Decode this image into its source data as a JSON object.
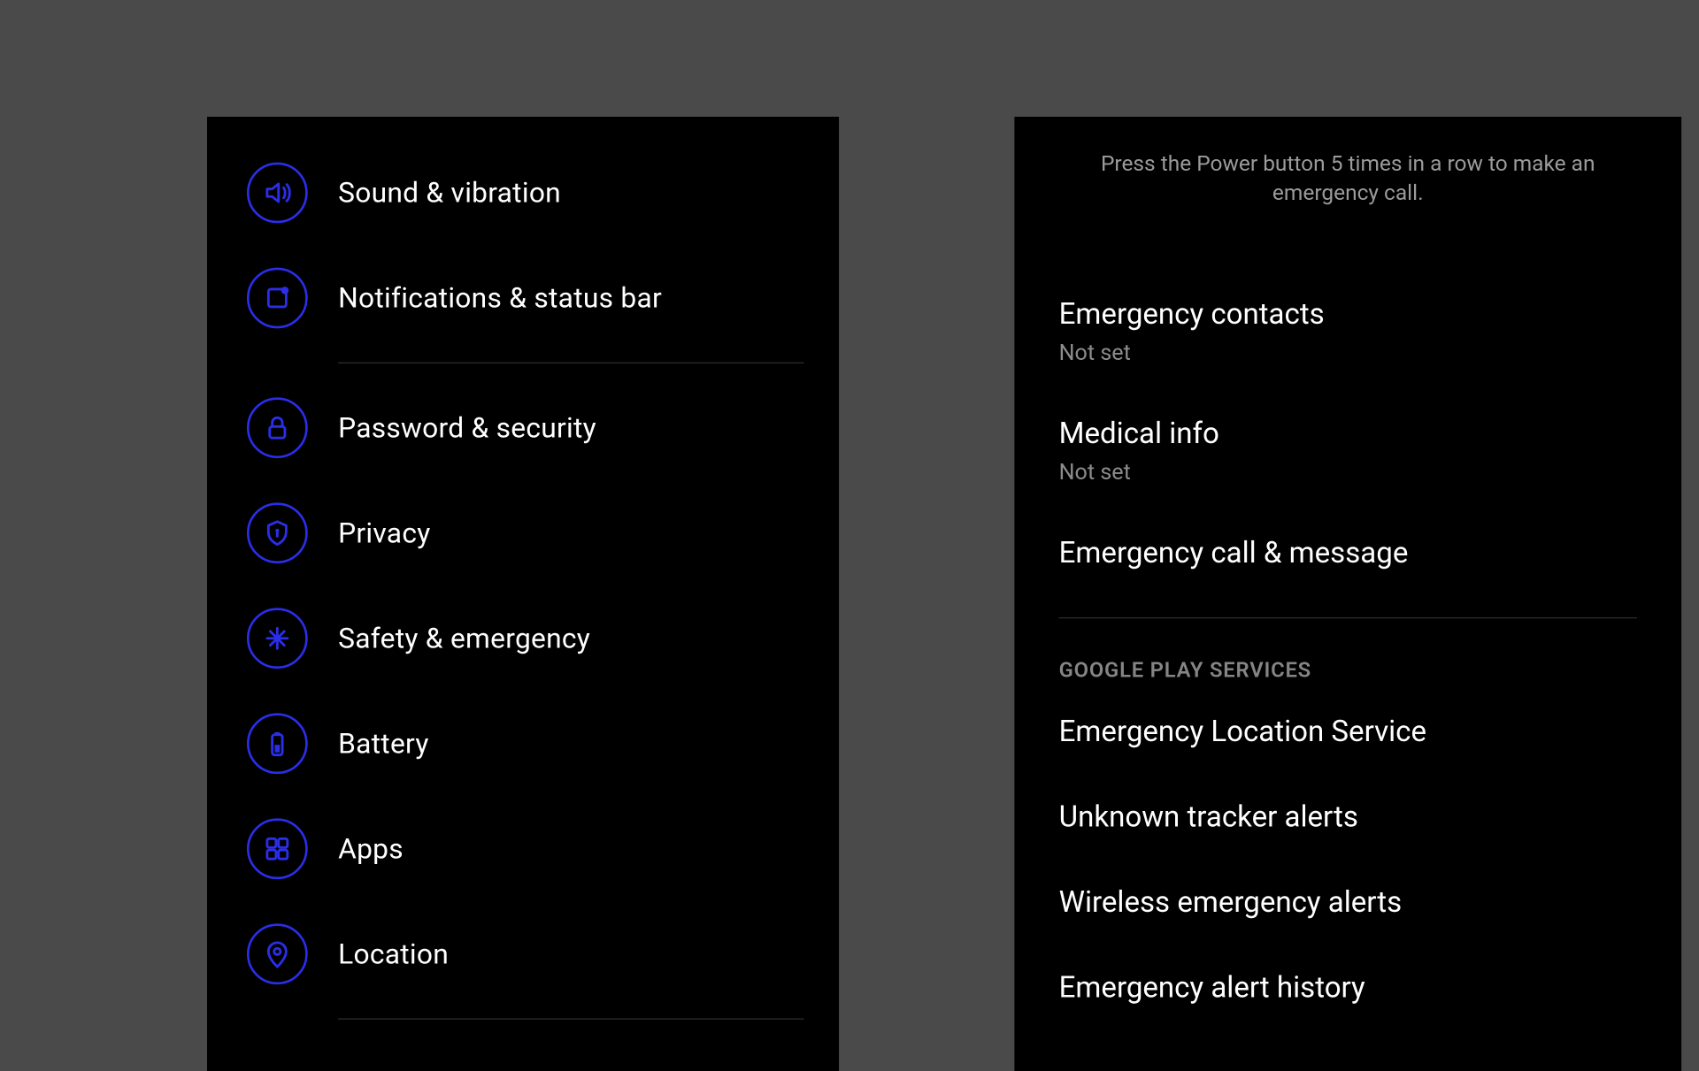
{
  "colors": {
    "bg_outer": "#4a4a4a",
    "bg_panel": "#000000",
    "accent": "#2a2ee8",
    "text_primary": "#ffffff",
    "text_secondary": "#8c8c8c",
    "divider": "#2b2b2b"
  },
  "left": {
    "items": [
      {
        "icon": "sound-icon",
        "label": "Sound & vibration"
      },
      {
        "icon": "notification-icon",
        "label": "Notifications & status bar"
      }
    ],
    "items2": [
      {
        "icon": "lock-icon",
        "label": "Password & security"
      },
      {
        "icon": "shield-icon",
        "label": "Privacy"
      },
      {
        "icon": "medical-icon",
        "label": "Safety & emergency"
      },
      {
        "icon": "battery-icon",
        "label": "Battery"
      },
      {
        "icon": "apps-icon",
        "label": "Apps"
      },
      {
        "icon": "pin-icon",
        "label": "Location"
      }
    ]
  },
  "right": {
    "hint": "Press the Power button 5 times in a row to make an emergency call.",
    "group1": [
      {
        "title": "Emergency contacts",
        "sub": "Not set"
      },
      {
        "title": "Medical info",
        "sub": "Not set"
      },
      {
        "title": "Emergency call & message"
      }
    ],
    "section_header": "GOOGLE PLAY SERVICES",
    "group2": [
      {
        "title": "Emergency Location Service"
      },
      {
        "title": "Unknown tracker alerts"
      },
      {
        "title": "Wireless emergency alerts"
      },
      {
        "title": "Emergency alert history"
      }
    ]
  }
}
